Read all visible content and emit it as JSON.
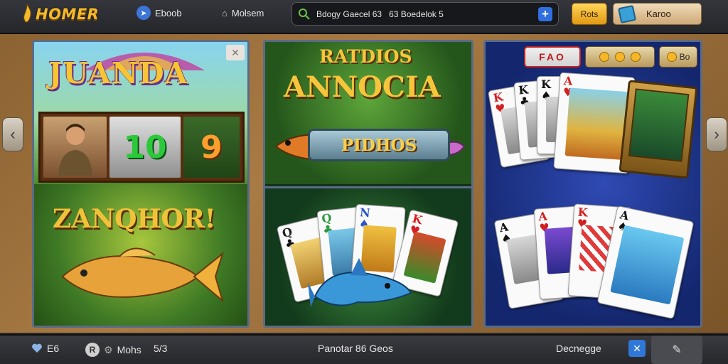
{
  "header": {
    "logo_text": "HOMER",
    "nav": [
      {
        "label": "Eboob",
        "icon": "compass-icon"
      },
      {
        "label": "Molsem",
        "icon": "house-icon"
      }
    ],
    "search": {
      "value": "Bdogy Gaecel 63   63 Boedelok 5",
      "icon": "search-icon"
    },
    "btn_gold": "Rots",
    "btn_tan": "Karoo"
  },
  "panels": {
    "p1": {
      "title": "JUANDA",
      "reel_numbers": [
        "10",
        "9"
      ],
      "subtitle": "ZANQHOR!"
    },
    "p2": {
      "title_top": "RATDIOS",
      "title_main": "ANNOCIA",
      "banner": "PIDHOS"
    },
    "p3": {
      "chip_red": "FAO",
      "chip_small": "Bo"
    }
  },
  "cards": {
    "p2": [
      {
        "rank": "Q",
        "color": "blk"
      },
      {
        "rank": "Q",
        "color": "blk"
      },
      {
        "rank": "N",
        "color": "blk"
      },
      {
        "rank": "K",
        "color": "red"
      }
    ],
    "p3_top": [
      {
        "rank": "K",
        "color": "red"
      },
      {
        "rank": "K",
        "color": "blk"
      },
      {
        "rank": "K",
        "color": "blk"
      },
      {
        "rank": "A",
        "color": "red"
      }
    ],
    "p3_bottom": [
      {
        "rank": "A",
        "color": "blk"
      },
      {
        "rank": "A",
        "color": "red"
      },
      {
        "rank": "K",
        "color": "red"
      },
      {
        "rank": "A",
        "color": "blk"
      }
    ]
  },
  "footer": {
    "left_a": "E6",
    "left_b": "Mohs",
    "left_c": "5/3",
    "center": "Panotar 86 Geos",
    "right": "Decnegge"
  }
}
